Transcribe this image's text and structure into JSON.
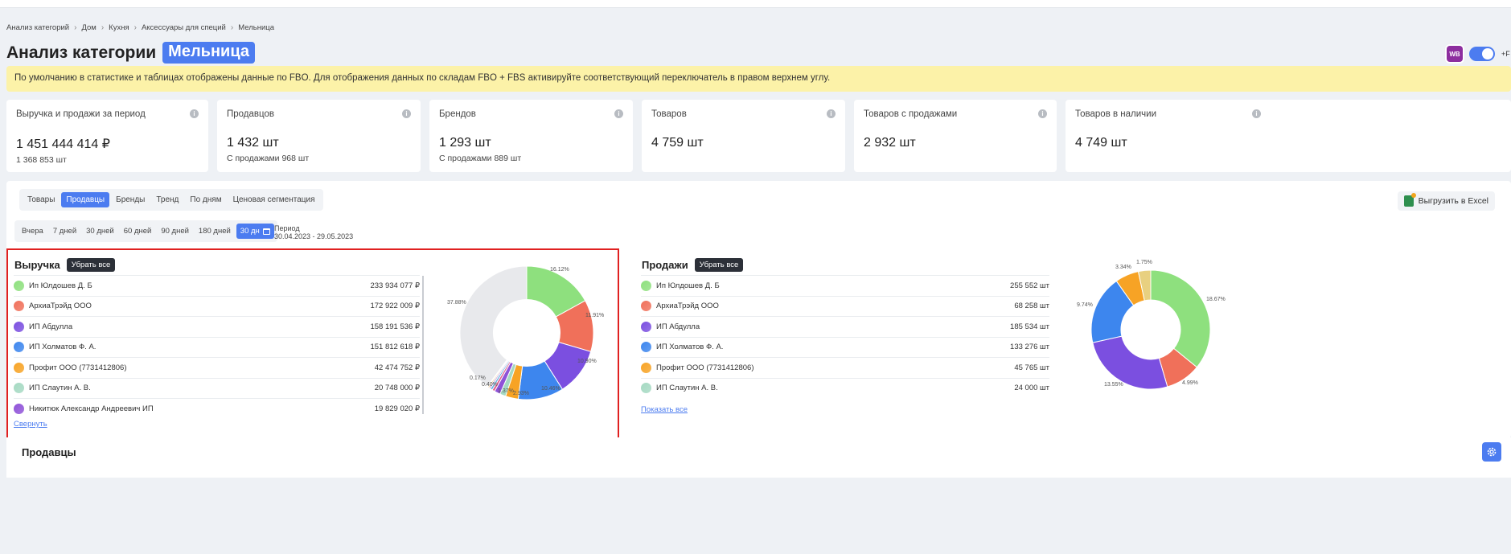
{
  "breadcrumb": [
    "Анализ категорий",
    "Дом",
    "Кухня",
    "Аксессуары для специй",
    "Мельница"
  ],
  "page_title": "Анализ категории",
  "category_chip": "Мельница",
  "wb_badge": "WB",
  "toggle_label": "+F",
  "notice": "По умолчанию в статистике и таблицах отображены данные по FBO. Для отображения данных по складам FBO + FBS активируйте соответствующий переключатель в правом верхнем углу.",
  "stats": [
    {
      "label": "Выручка и продажи за период",
      "value": "1 451 444 414 ₽",
      "sub": "1 368 853 шт"
    },
    {
      "label": "Продавцов",
      "value": "1 432 шт",
      "sub": "С продажами 968 шт"
    },
    {
      "label": "Брендов",
      "value": "1 293 шт",
      "sub": "С продажами 889 шт"
    },
    {
      "label": "Товаров",
      "value": "4 759 шт",
      "sub": ""
    },
    {
      "label": "Товаров с продажами",
      "value": "2 932 шт",
      "sub": ""
    },
    {
      "label": "Товаров в наличии",
      "value": "4 749 шт",
      "sub": ""
    }
  ],
  "tabs": [
    "Товары",
    "Продавцы",
    "Бренды",
    "Тренд",
    "По дням",
    "Ценовая сегментация"
  ],
  "export_label": "Выгрузить в Excel",
  "periods": [
    "Вчера",
    "7 дней",
    "30 дней",
    "60 дней",
    "90 дней",
    "180 дней",
    "30 дн"
  ],
  "period_caption": "Период",
  "period_range": "30.04.2023 - 29.05.2023",
  "revenue": {
    "title": "Выручка",
    "clear_btn": "Убрать все",
    "collapse_link": "Свернуть",
    "rows": [
      {
        "name": "Ип Юлдошев Д. Б",
        "value": "233 934 077 ₽",
        "color": "#8ee07e"
      },
      {
        "name": "АрхиаТрэйд ООО",
        "value": "172 922 009 ₽",
        "color": "#f0705a"
      },
      {
        "name": "ИП Абдулла",
        "value": "158 191 536 ₽",
        "color": "#7b4fe0"
      },
      {
        "name": "ИП Холматов Ф. А.",
        "value": "151 812 618 ₽",
        "color": "#3d86ee"
      },
      {
        "name": "Профит ООО (7731412806)",
        "value": "42 474 752 ₽",
        "color": "#f7a325"
      },
      {
        "name": "ИП Слаутин А. В.",
        "value": "20 748 000 ₽",
        "color": "#a5d9c2"
      },
      {
        "name": "Никитюк Александр Андреевич ИП",
        "value": "19 829 020 ₽",
        "color": "#8f52d8"
      }
    ]
  },
  "sales": {
    "title": "Продажи",
    "clear_btn": "Убрать все",
    "show_all_link": "Показать все",
    "rows": [
      {
        "name": "Ип Юлдошев Д. Б",
        "value": "255 552 шт",
        "color": "#8ee07e"
      },
      {
        "name": "АрхиаТрэйд ООО",
        "value": "68 258 шт",
        "color": "#f0705a"
      },
      {
        "name": "ИП Абдулла",
        "value": "185 534 шт",
        "color": "#7b4fe0"
      },
      {
        "name": "ИП Холматов Ф. А.",
        "value": "133 276 шт",
        "color": "#3d86ee"
      },
      {
        "name": "Профит ООО (7731412806)",
        "value": "45 765 шт",
        "color": "#f7a325"
      },
      {
        "name": "ИП Слаутин А. В.",
        "value": "24 000 шт",
        "color": "#a5d9c2"
      }
    ]
  },
  "revenue_donut": {
    "slices": [
      {
        "label": "16.12%",
        "value": 16.12,
        "color": "#8ee07e"
      },
      {
        "label": "11.91%",
        "value": 11.91,
        "color": "#f0705a"
      },
      {
        "label": "10.90%",
        "value": 10.9,
        "color": "#7b4fe0"
      },
      {
        "label": "10.46%",
        "value": 10.46,
        "color": "#3d86ee"
      },
      {
        "label": "2.93%",
        "value": 2.93,
        "color": "#f7a325"
      },
      {
        "label": "1.37%",
        "value": 1.37,
        "color": "#a5d9c2"
      },
      {
        "label": "",
        "value": 1.37,
        "color": "#8f52d8"
      },
      {
        "label": "",
        "value": 0.6,
        "color": "#e06090"
      },
      {
        "label": "",
        "value": 0.5,
        "color": "#60b0e0"
      },
      {
        "label": "0.40%",
        "value": 0.4,
        "color": "#c0a0e0"
      },
      {
        "label": "",
        "value": 0.3,
        "color": "#f0c060"
      },
      {
        "label": "0.17%",
        "value": 0.17,
        "color": "#90d0a0"
      },
      {
        "label": "37.88%",
        "value": 37.88,
        "color": "#e8e9ec"
      }
    ]
  },
  "sales_donut": {
    "slices": [
      {
        "label": "18.67%",
        "value": 18.67,
        "color": "#8ee07e"
      },
      {
        "label": "4.99%",
        "value": 4.99,
        "color": "#f0705a"
      },
      {
        "label": "13.55%",
        "value": 13.55,
        "color": "#7b4fe0"
      },
      {
        "label": "9.74%",
        "value": 9.74,
        "color": "#3d86ee"
      },
      {
        "label": "3.34%",
        "value": 3.34,
        "color": "#f7a325"
      },
      {
        "label": "1.75%",
        "value": 1.75,
        "color": "#e8d080"
      }
    ]
  },
  "sellers_title": "Продавцы"
}
